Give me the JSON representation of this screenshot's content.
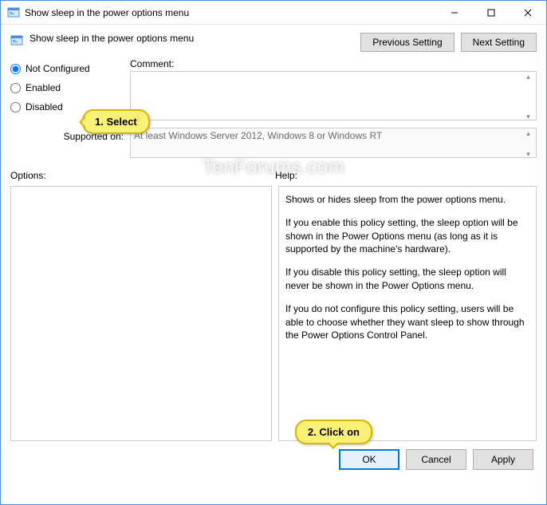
{
  "window": {
    "title": "Show sleep in the power options menu"
  },
  "subtitle": "Show sleep in the power options menu",
  "nav": {
    "previous": "Previous Setting",
    "next": "Next Setting"
  },
  "radios": {
    "not_configured": "Not Configured",
    "enabled": "Enabled",
    "disabled": "Disabled"
  },
  "labels": {
    "comment": "Comment:",
    "supported": "Supported on:",
    "options": "Options:",
    "help": "Help:"
  },
  "supported_text": "At least Windows Server 2012, Windows 8 or Windows RT",
  "help": {
    "p1": "Shows or hides sleep from the power options menu.",
    "p2": "If you enable this policy setting, the sleep option will be shown in the Power Options menu (as long as it is supported by the machine's hardware).",
    "p3": "If you disable this policy setting, the sleep option will never be shown in the Power Options menu.",
    "p4": "If you do not configure this policy setting, users will be able to choose whether they want sleep to show through the Power Options Control Panel."
  },
  "footer": {
    "ok": "OK",
    "cancel": "Cancel",
    "apply": "Apply"
  },
  "callouts": {
    "select": "1. Select",
    "click": "2. Click on"
  },
  "watermark": "TenForums.com"
}
